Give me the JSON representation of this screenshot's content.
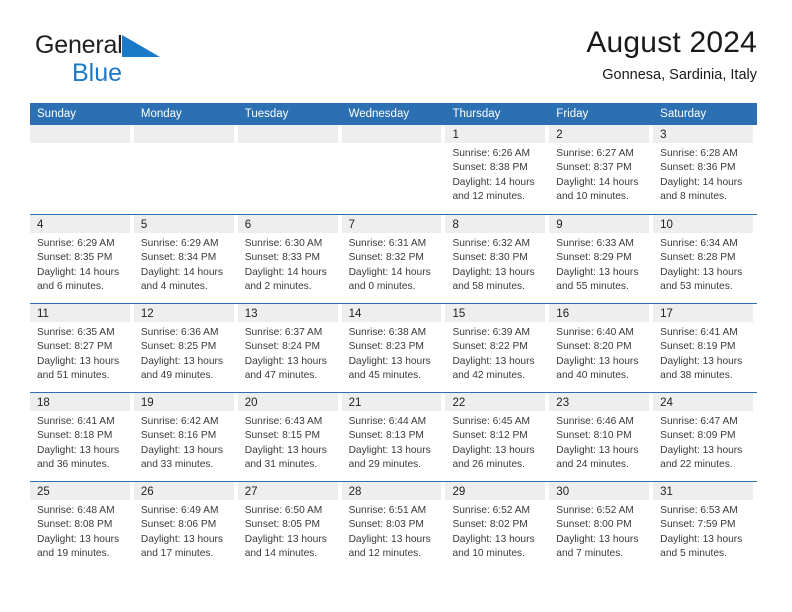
{
  "brand": {
    "name_part1": "General",
    "name_part2": "Blue",
    "triangle_color": "#1b7ac7",
    "text_color": "#231f20"
  },
  "header": {
    "title": "August 2024",
    "subtitle": "Gonnesa, Sardinia, Italy"
  },
  "theme": {
    "header_blue": "#2b70b3",
    "date_strip_gray": "#eeeeee",
    "text_color": "#3a3a3a"
  },
  "weekdays": [
    "Sunday",
    "Monday",
    "Tuesday",
    "Wednesday",
    "Thursday",
    "Friday",
    "Saturday"
  ],
  "weeks": [
    [
      {
        "day": "",
        "lines": []
      },
      {
        "day": "",
        "lines": []
      },
      {
        "day": "",
        "lines": []
      },
      {
        "day": "",
        "lines": []
      },
      {
        "day": "1",
        "lines": [
          "Sunrise: 6:26 AM",
          "Sunset: 8:38 PM",
          "Daylight: 14 hours",
          "and 12 minutes."
        ]
      },
      {
        "day": "2",
        "lines": [
          "Sunrise: 6:27 AM",
          "Sunset: 8:37 PM",
          "Daylight: 14 hours",
          "and 10 minutes."
        ]
      },
      {
        "day": "3",
        "lines": [
          "Sunrise: 6:28 AM",
          "Sunset: 8:36 PM",
          "Daylight: 14 hours",
          "and 8 minutes."
        ]
      }
    ],
    [
      {
        "day": "4",
        "lines": [
          "Sunrise: 6:29 AM",
          "Sunset: 8:35 PM",
          "Daylight: 14 hours",
          "and 6 minutes."
        ]
      },
      {
        "day": "5",
        "lines": [
          "Sunrise: 6:29 AM",
          "Sunset: 8:34 PM",
          "Daylight: 14 hours",
          "and 4 minutes."
        ]
      },
      {
        "day": "6",
        "lines": [
          "Sunrise: 6:30 AM",
          "Sunset: 8:33 PM",
          "Daylight: 14 hours",
          "and 2 minutes."
        ]
      },
      {
        "day": "7",
        "lines": [
          "Sunrise: 6:31 AM",
          "Sunset: 8:32 PM",
          "Daylight: 14 hours",
          "and 0 minutes."
        ]
      },
      {
        "day": "8",
        "lines": [
          "Sunrise: 6:32 AM",
          "Sunset: 8:30 PM",
          "Daylight: 13 hours",
          "and 58 minutes."
        ]
      },
      {
        "day": "9",
        "lines": [
          "Sunrise: 6:33 AM",
          "Sunset: 8:29 PM",
          "Daylight: 13 hours",
          "and 55 minutes."
        ]
      },
      {
        "day": "10",
        "lines": [
          "Sunrise: 6:34 AM",
          "Sunset: 8:28 PM",
          "Daylight: 13 hours",
          "and 53 minutes."
        ]
      }
    ],
    [
      {
        "day": "11",
        "lines": [
          "Sunrise: 6:35 AM",
          "Sunset: 8:27 PM",
          "Daylight: 13 hours",
          "and 51 minutes."
        ]
      },
      {
        "day": "12",
        "lines": [
          "Sunrise: 6:36 AM",
          "Sunset: 8:25 PM",
          "Daylight: 13 hours",
          "and 49 minutes."
        ]
      },
      {
        "day": "13",
        "lines": [
          "Sunrise: 6:37 AM",
          "Sunset: 8:24 PM",
          "Daylight: 13 hours",
          "and 47 minutes."
        ]
      },
      {
        "day": "14",
        "lines": [
          "Sunrise: 6:38 AM",
          "Sunset: 8:23 PM",
          "Daylight: 13 hours",
          "and 45 minutes."
        ]
      },
      {
        "day": "15",
        "lines": [
          "Sunrise: 6:39 AM",
          "Sunset: 8:22 PM",
          "Daylight: 13 hours",
          "and 42 minutes."
        ]
      },
      {
        "day": "16",
        "lines": [
          "Sunrise: 6:40 AM",
          "Sunset: 8:20 PM",
          "Daylight: 13 hours",
          "and 40 minutes."
        ]
      },
      {
        "day": "17",
        "lines": [
          "Sunrise: 6:41 AM",
          "Sunset: 8:19 PM",
          "Daylight: 13 hours",
          "and 38 minutes."
        ]
      }
    ],
    [
      {
        "day": "18",
        "lines": [
          "Sunrise: 6:41 AM",
          "Sunset: 8:18 PM",
          "Daylight: 13 hours",
          "and 36 minutes."
        ]
      },
      {
        "day": "19",
        "lines": [
          "Sunrise: 6:42 AM",
          "Sunset: 8:16 PM",
          "Daylight: 13 hours",
          "and 33 minutes."
        ]
      },
      {
        "day": "20",
        "lines": [
          "Sunrise: 6:43 AM",
          "Sunset: 8:15 PM",
          "Daylight: 13 hours",
          "and 31 minutes."
        ]
      },
      {
        "day": "21",
        "lines": [
          "Sunrise: 6:44 AM",
          "Sunset: 8:13 PM",
          "Daylight: 13 hours",
          "and 29 minutes."
        ]
      },
      {
        "day": "22",
        "lines": [
          "Sunrise: 6:45 AM",
          "Sunset: 8:12 PM",
          "Daylight: 13 hours",
          "and 26 minutes."
        ]
      },
      {
        "day": "23",
        "lines": [
          "Sunrise: 6:46 AM",
          "Sunset: 8:10 PM",
          "Daylight: 13 hours",
          "and 24 minutes."
        ]
      },
      {
        "day": "24",
        "lines": [
          "Sunrise: 6:47 AM",
          "Sunset: 8:09 PM",
          "Daylight: 13 hours",
          "and 22 minutes."
        ]
      }
    ],
    [
      {
        "day": "25",
        "lines": [
          "Sunrise: 6:48 AM",
          "Sunset: 8:08 PM",
          "Daylight: 13 hours",
          "and 19 minutes."
        ]
      },
      {
        "day": "26",
        "lines": [
          "Sunrise: 6:49 AM",
          "Sunset: 8:06 PM",
          "Daylight: 13 hours",
          "and 17 minutes."
        ]
      },
      {
        "day": "27",
        "lines": [
          "Sunrise: 6:50 AM",
          "Sunset: 8:05 PM",
          "Daylight: 13 hours",
          "and 14 minutes."
        ]
      },
      {
        "day": "28",
        "lines": [
          "Sunrise: 6:51 AM",
          "Sunset: 8:03 PM",
          "Daylight: 13 hours",
          "and 12 minutes."
        ]
      },
      {
        "day": "29",
        "lines": [
          "Sunrise: 6:52 AM",
          "Sunset: 8:02 PM",
          "Daylight: 13 hours",
          "and 10 minutes."
        ]
      },
      {
        "day": "30",
        "lines": [
          "Sunrise: 6:52 AM",
          "Sunset: 8:00 PM",
          "Daylight: 13 hours",
          "and 7 minutes."
        ]
      },
      {
        "day": "31",
        "lines": [
          "Sunrise: 6:53 AM",
          "Sunset: 7:59 PM",
          "Daylight: 13 hours",
          "and 5 minutes."
        ]
      }
    ]
  ]
}
